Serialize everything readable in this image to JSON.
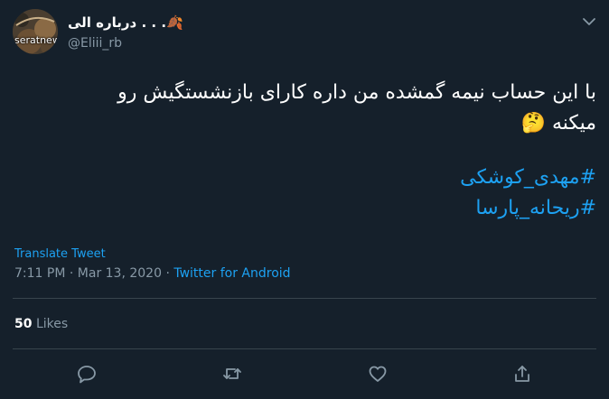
{
  "tweet": {
    "author": {
      "display_name": "درباره الی . . .",
      "name_emoji": "🍂",
      "handle": "@Eliii_rb",
      "avatar_watermark": "seratnews.ir"
    },
    "text_line1": "با این حساب نیمه گمشده من داره کارای بازنشستگیش رو",
    "text_line2": "میکنه",
    "text_emoji": "🤔",
    "hashtags": [
      "#مهدی_کوشکی",
      "#ریحانه_پارسا"
    ],
    "translate_label": "Translate Tweet",
    "time": "7:11 PM",
    "separator": "·",
    "date": "Mar 13, 2020",
    "source": "Twitter for Android",
    "likes_count": "50",
    "likes_label": "Likes"
  },
  "actions": {
    "reply_icon": "reply-icon",
    "retweet_icon": "retweet-icon",
    "like_icon": "heart-icon",
    "share_icon": "share-icon"
  },
  "colors": {
    "background": "#15202b",
    "accent": "#1da1f2",
    "secondary_text": "#8899a6",
    "divider": "#38444d"
  }
}
